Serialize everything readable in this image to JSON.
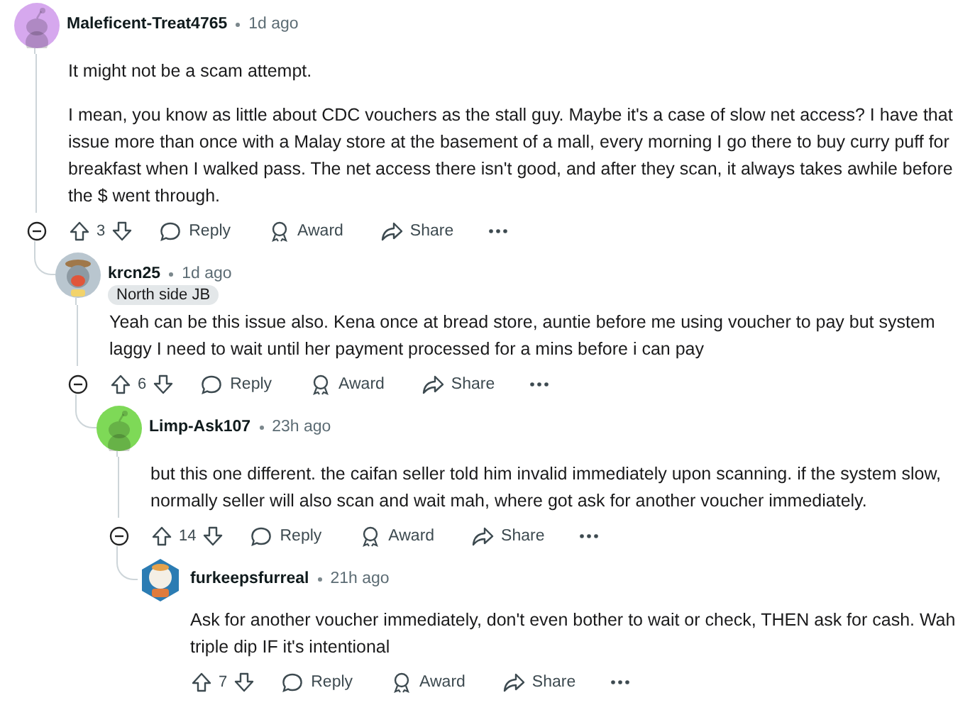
{
  "comments": [
    {
      "author": "Maleficent-Treat4765",
      "time": "1d ago",
      "avatar": {
        "kind": "default",
        "color": "#d6a8ee"
      },
      "paragraphs": [
        "It might not be a scam attempt.",
        "I mean, you know as little about CDC vouchers as the stall guy. Maybe it's a case of slow net access? I have that issue more than once with a Malay store at the basement of a mall, every morning I go there to buy curry puff for breakfast when I walked pass. The net access there isn't good, and after they scan, it always takes awhile before the $ went through."
      ],
      "votes": "3",
      "actions": [
        "Reply",
        "Award",
        "Share"
      ],
      "children": [
        {
          "author": "krcn25",
          "time": "1d ago",
          "flair": "North side JB",
          "avatar": {
            "kind": "character",
            "color": "#b9c6cf"
          },
          "paragraphs": [
            "Yeah can be this issue also. Kena once at bread store, auntie before me using voucher to pay but system laggy I need to wait until her payment processed for a mins before i can pay"
          ],
          "votes": "6",
          "actions": [
            "Reply",
            "Award",
            "Share"
          ],
          "children": [
            {
              "author": "Limp-Ask107",
              "time": "23h ago",
              "avatar": {
                "kind": "default",
                "color": "#7ed957"
              },
              "paragraphs": [
                "but this one different. the caifan seller told him invalid immediately upon scanning.  if the system slow, normally seller will also scan and wait mah, where got ask for another voucher immediately."
              ],
              "votes": "14",
              "actions": [
                "Reply",
                "Award",
                "Share"
              ],
              "children": [
                {
                  "author": "furkeepsfurreal",
                  "time": "21h ago",
                  "avatar": {
                    "kind": "hexagon",
                    "color": "#2b7cb3"
                  },
                  "paragraphs": [
                    "Ask for another voucher immediately, don't even bother to wait or check, THEN ask for cash. Wah triple dip IF it's intentional"
                  ],
                  "votes": "7",
                  "actions": [
                    "Reply",
                    "Award",
                    "Share"
                  ]
                }
              ]
            }
          ]
        }
      ]
    }
  ]
}
